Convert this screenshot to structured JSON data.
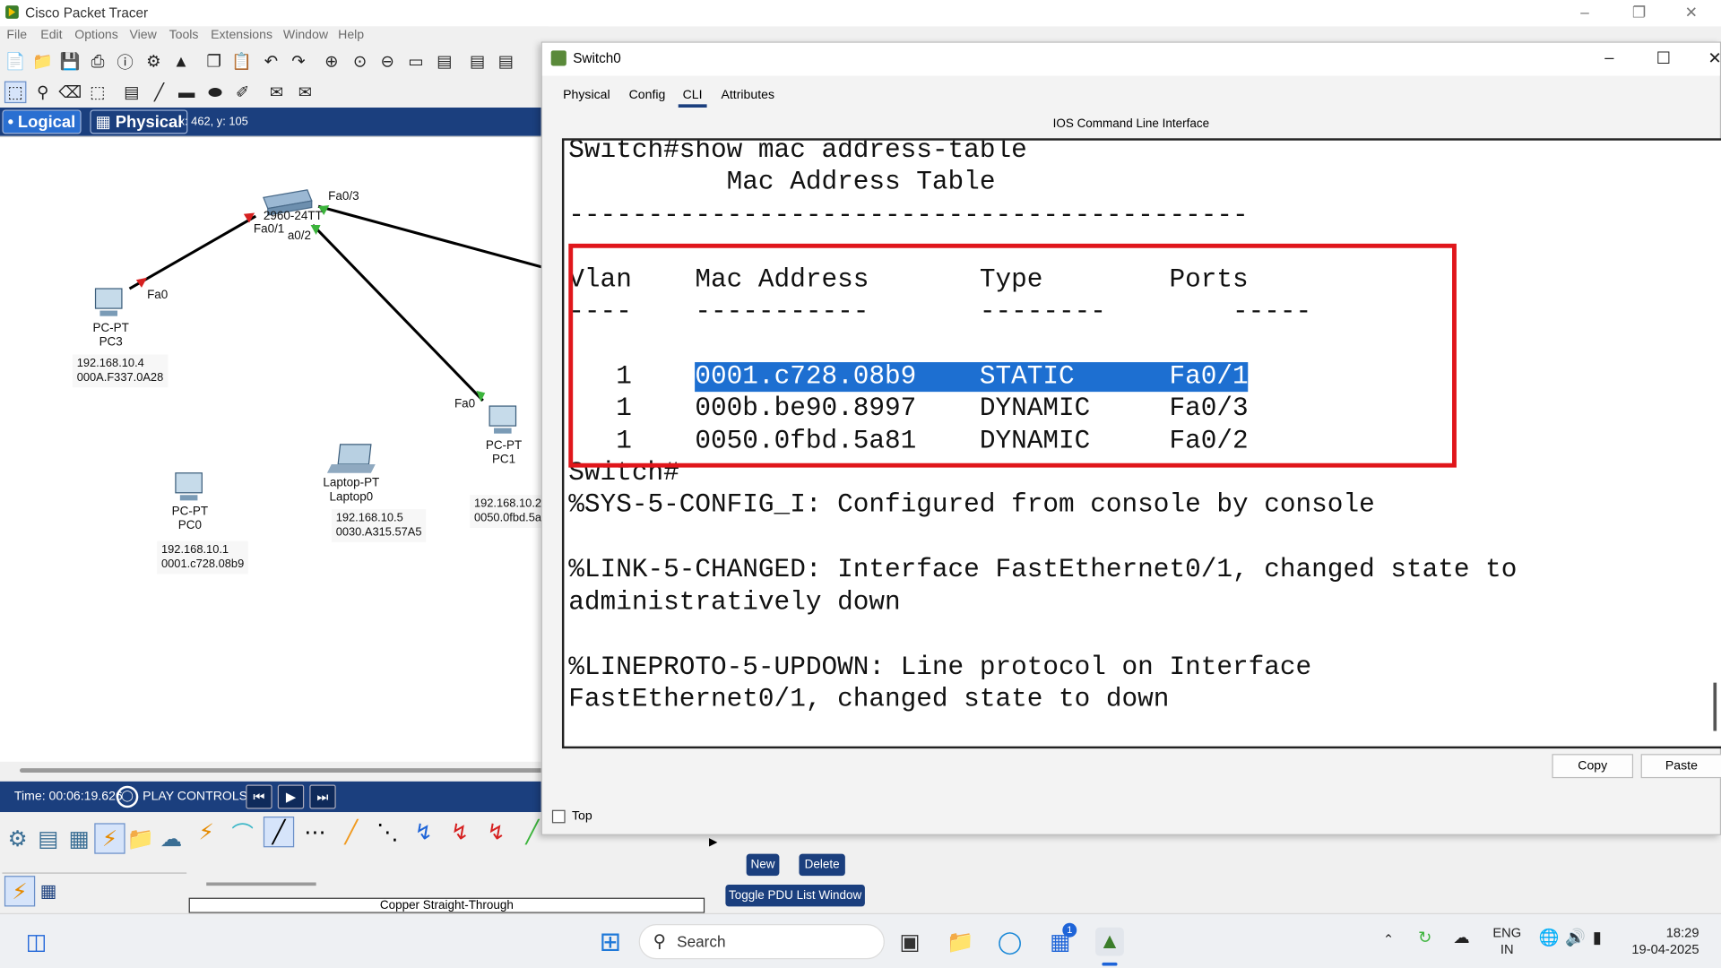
{
  "app": {
    "title": "Cisco Packet Tracer"
  },
  "menu": [
    "File",
    "Edit",
    "Options",
    "View",
    "Tools",
    "Extensions",
    "Window",
    "Help"
  ],
  "view_tabs": {
    "logical": "Logical",
    "physical": "Physical",
    "coords": "x: 462, y: 105"
  },
  "topology": {
    "switch": {
      "model": "2960-24TT",
      "ports": [
        "Fa0/3",
        "Fa0/1",
        "a0/2"
      ]
    },
    "pc3": {
      "type": "PC-PT",
      "name": "PC3",
      "port": "Fa0",
      "ip": "192.168.10.4",
      "mac": "000A.F337.0A28"
    },
    "pc1": {
      "type": "PC-PT",
      "name": "PC1",
      "port": "Fa0",
      "ip": "192.168.10.2",
      "mac": "0050.0fbd.5a"
    },
    "pc0": {
      "type": "PC-PT",
      "name": "PC0",
      "ip": "192.168.10.1",
      "mac": "0001.c728.08b9"
    },
    "laptop0": {
      "type": "Laptop-PT",
      "name": "Laptop0",
      "ip": "192.168.10.5",
      "mac": "0030.A315.57A5"
    }
  },
  "timebar": {
    "time": "Time: 00:06:19.626",
    "play_controls": "PLAY CONTROLS:"
  },
  "bottom": {
    "cable_caption": "Copper Straight-Through",
    "pdu_new": "New",
    "pdu_delete": "Delete",
    "pdu_toggle": "Toggle PDU List Window"
  },
  "dialog": {
    "title": "Switch0",
    "tabs": [
      "Physical",
      "Config",
      "CLI",
      "Attributes"
    ],
    "active_tab": "CLI",
    "cli_header": "IOS Command Line Interface",
    "terminal": {
      "command_line": "Switch#show mac address-table",
      "table_title": "          Mac Address Table",
      "rule": "-------------------------------------------",
      "headers": [
        "Vlan",
        "Mac Address",
        "Type",
        "Ports"
      ],
      "header_rules": [
        "----",
        "-----------",
        "--------",
        "-----"
      ],
      "rows": [
        {
          "vlan": "1",
          "mac": "0001.c728.08b9",
          "type": "STATIC",
          "port": "Fa0/1",
          "selected": true
        },
        {
          "vlan": "1",
          "mac": "000b.be90.8997",
          "type": "DYNAMIC",
          "port": "Fa0/3",
          "selected": false
        },
        {
          "vlan": "1",
          "mac": "0050.0fbd.5a81",
          "type": "DYNAMIC",
          "port": "Fa0/2",
          "selected": false
        }
      ],
      "prompt": "Switch#",
      "log": [
        "%SYS-5-CONFIG_I: Configured from console by console",
        "",
        "%LINK-5-CHANGED: Interface FastEthernet0/1, changed state to",
        "administratively down",
        "",
        "%LINEPROTO-5-UPDOWN: Line protocol on Interface",
        "FastEthernet0/1, changed state to down"
      ]
    },
    "copy_label": "Copy",
    "paste_label": "Paste",
    "top_label": "Top"
  },
  "taskbar": {
    "search_placeholder": "Search",
    "lang_top": "ENG",
    "lang_bottom": "IN",
    "time": "18:29",
    "date": "19-04-2025",
    "store_badge": "1"
  },
  "colors": {
    "highlight": "#1d6fd1",
    "annotation_box": "#e0161b",
    "panel_blue": "#1b3f7e"
  }
}
